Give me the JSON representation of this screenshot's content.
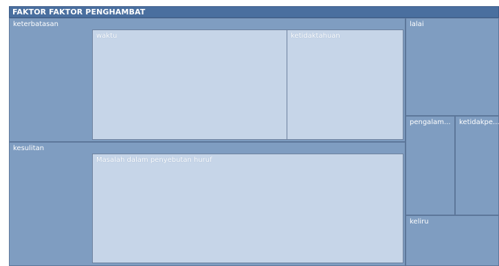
{
  "chart_data": {
    "type": "treemap",
    "title": "FAKTOR FAKTOR PENGHAMBAT",
    "nodes": [
      {
        "name": "keterbatasan",
        "children": [
          {
            "name": "waktu"
          },
          {
            "name": "ketidaktahuan"
          }
        ]
      },
      {
        "name": "kesulitan",
        "children": [
          {
            "name": "Masalah dalam penyebutan huruf"
          }
        ]
      },
      {
        "name": "lalai"
      },
      {
        "name": "pengalam..."
      },
      {
        "name": "ketidakpe..."
      },
      {
        "name": "keliru"
      }
    ]
  },
  "colors": {
    "title_bar": "#4a6f9f",
    "parent_fill": "#7f9dc1",
    "child_fill": "#c6d5e8",
    "border": "#5c7699"
  }
}
